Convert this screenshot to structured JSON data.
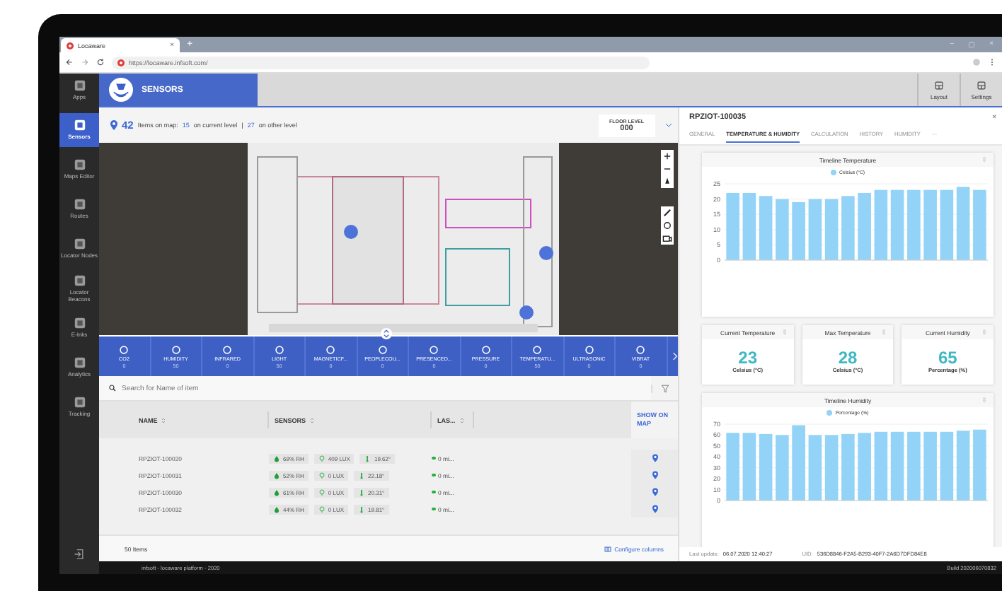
{
  "browser": {
    "tab": {
      "title": "Locaware",
      "close": "×"
    },
    "new_tab": "+",
    "window_controls": [
      "–",
      "▢",
      "×"
    ],
    "url": "https://locaware.infsoft.com/"
  },
  "sidebar": {
    "items": [
      {
        "label": "Apps",
        "selected": false
      },
      {
        "label": "Sensors",
        "selected": true
      },
      {
        "label": "Maps Editor",
        "selected": false
      },
      {
        "label": "Routes",
        "selected": false
      },
      {
        "label": "Locator Nodes",
        "selected": false
      },
      {
        "label": "Locator Beacons",
        "selected": false
      },
      {
        "label": "E-Inks",
        "selected": false
      },
      {
        "label": "Analytics",
        "selected": false
      },
      {
        "label": "Tracking",
        "selected": false
      }
    ]
  },
  "header": {
    "title": "SENSORS",
    "buttons": [
      "Layout",
      "Settings"
    ]
  },
  "info": {
    "count": "42",
    "label": "Items on map:",
    "current_count": "15",
    "current_label": "on current level",
    "separator": "|",
    "other_count": "27",
    "other_label": "on other level"
  },
  "floor": {
    "label": "FLOOR LEVEL",
    "value": "000"
  },
  "categories": [
    {
      "label": "CO2",
      "count": "0"
    },
    {
      "label": "HUMIDITY",
      "count": "50"
    },
    {
      "label": "INFRARED",
      "count": "0"
    },
    {
      "label": "LIGHT",
      "count": "50"
    },
    {
      "label": "MAGNETICF...",
      "count": "0"
    },
    {
      "label": "PEOPLECOU...",
      "count": "0"
    },
    {
      "label": "PRESENCED...",
      "count": "0"
    },
    {
      "label": "PRESSURE",
      "count": "0"
    },
    {
      "label": "TEMPERATU...",
      "count": "50"
    },
    {
      "label": "ULTRASONIC",
      "count": "0"
    },
    {
      "label": "VIBRAT",
      "count": "0"
    }
  ],
  "search": {
    "placeholder": "Search for Name of item"
  },
  "table": {
    "columns": [
      "NAME",
      "SENSORS",
      "LAS..."
    ],
    "map_column": "SHOW ON MAP",
    "rows": [
      {
        "name": "RPZIOT-100020",
        "humidity": "69% RH",
        "light": "409 LUX",
        "temperature": "19.62°",
        "last": "0 mi...",
        "color": "#1db33a"
      },
      {
        "name": "RPZIOT-100031",
        "humidity": "52% RH",
        "light": "0 LUX",
        "temperature": "22.18°",
        "last": "0 mi...",
        "color": "#1db33a"
      },
      {
        "name": "RPZIOT-100030",
        "humidity": "61% RH",
        "light": "0 LUX",
        "temperature": "20.31°",
        "last": "0 mi...",
        "color": "#1db33a"
      },
      {
        "name": "RPZIOT-100032",
        "humidity": "44% RH",
        "light": "0 LUX",
        "temperature": "19.81°",
        "last": "0 mi...",
        "color": "#1db33a"
      }
    ],
    "count": "50 Items",
    "configure": "Configure columns"
  },
  "footer": {
    "left": "infsoft - locaware platform - 2020",
    "build": "Build 202006070832"
  },
  "detail": {
    "title": "RPZIOT-100035",
    "close": "×",
    "tabs": [
      {
        "label": "GENERAL",
        "selected": false
      },
      {
        "label": "TEMPERATURE & HUMIDITY",
        "selected": true
      },
      {
        "label": "CALCULATION",
        "selected": false
      },
      {
        "label": "HISTORY",
        "selected": false
      },
      {
        "label": "HUMIDITY",
        "selected": false
      },
      {
        "label": "···",
        "selected": false
      }
    ],
    "sections": [
      {
        "kind": "chart",
        "title": "Timeline Temperature",
        "chart_data": {
          "type": "bar",
          "grid": true,
          "ylim": [
            0,
            25
          ],
          "yticks": [
            0,
            5,
            10,
            15,
            20,
            25
          ],
          "series": [
            {
              "name": "Celsius (°C)",
              "color": "#93d3f7",
              "values": [
                22,
                22,
                21,
                20,
                19,
                20,
                20,
                21,
                22,
                23,
                23,
                23,
                23,
                23,
                24,
                23
              ]
            }
          ]
        }
      },
      {
        "kind": "stats",
        "items": [
          {
            "title": "Current Temperature",
            "value": "23",
            "unit": "Celsius (°C)"
          },
          {
            "title": "Max Temperature",
            "value": "28",
            "unit": "Celsius (°C)"
          },
          {
            "title": "Current Humidity",
            "value": "65",
            "unit": "Percentage (%)"
          }
        ]
      },
      {
        "kind": "chart",
        "title": "Timeline Humidity",
        "chart_data": {
          "type": "bar",
          "grid": true,
          "ylim": [
            0,
            70
          ],
          "yticks": [
            0,
            10,
            20,
            30,
            40,
            50,
            60,
            70
          ],
          "series": [
            {
              "name": "Percentage (%)",
              "color": "#93d3f7",
              "values": [
                62,
                62,
                61,
                60,
                69,
                60,
                60,
                61,
                62,
                63,
                63,
                63,
                63,
                63,
                64,
                65
              ]
            }
          ]
        }
      }
    ],
    "last_update_label": "Last update:",
    "last_update": "06.07.2020 12:40:27",
    "uid_label": "UID:",
    "uid": "536D8846-F2A5-B293-40F7-2A6D7DFD84E8"
  }
}
